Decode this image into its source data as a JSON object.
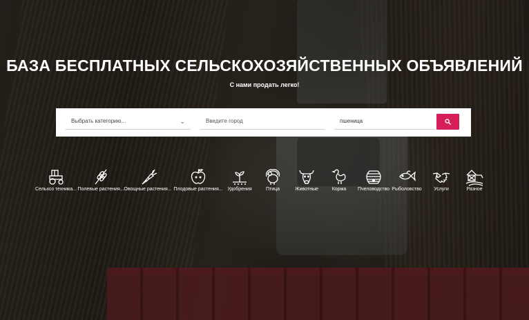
{
  "hero": {
    "title": "БАЗА БЕСПЛАТНЫХ СЕЛЬСКОХОЗЯЙСТВЕННЫХ ОБЪЯВЛЕНИЙ",
    "subtitle": "С нами продать легко!"
  },
  "search": {
    "category_value": "Выбрать категорию...",
    "city_placeholder": "Введите город",
    "query_value": "пшеница",
    "button_icon": "search-icon",
    "button_color": "#d61f59"
  },
  "categories": [
    {
      "label": "Сельхоз техника...",
      "icon": "tractor-icon"
    },
    {
      "label": "Полевые растения...",
      "icon": "wheat-icon"
    },
    {
      "label": "Овощные растения...",
      "icon": "carrot-icon"
    },
    {
      "label": "Плодовые растения...",
      "icon": "apple-icon"
    },
    {
      "label": "Удобрения",
      "icon": "sprout-icon"
    },
    {
      "label": "Птица",
      "icon": "turkey-icon"
    },
    {
      "label": "Животные",
      "icon": "bull-icon"
    },
    {
      "label": "Корма",
      "icon": "chicken-icon"
    },
    {
      "label": "Пчеловодство",
      "icon": "beehive-icon"
    },
    {
      "label": "Рыболовство",
      "icon": "fish-icon"
    },
    {
      "label": "Услуги",
      "icon": "handshake-icon"
    },
    {
      "label": "Разное",
      "icon": "barn-icon"
    }
  ]
}
